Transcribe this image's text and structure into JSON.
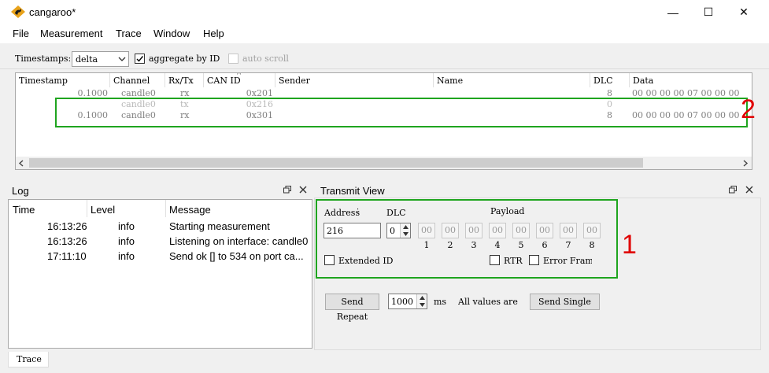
{
  "window": {
    "title": "cangaroo*",
    "minimize": "—",
    "maximize": "☐",
    "close": "✕"
  },
  "menu": [
    "File",
    "Measurement",
    "Trace",
    "Window",
    "Help"
  ],
  "toolbar": {
    "timestamps_label": "Timestamps:",
    "timestamps_value": "delta",
    "aggregate_label": "aggregate by ID",
    "aggregate_checked": true,
    "autoscroll_label": "auto scroll",
    "autoscroll_checked": false
  },
  "trace": {
    "columns": [
      "Timestamp",
      "Channel",
      "Rx/Tx",
      "CAN ID",
      "Sender",
      "Name",
      "DLC",
      "Data"
    ],
    "sort_indicator": "^",
    "rows": [
      {
        "timestamp": "0.1000",
        "channel": "candle0",
        "rxtx": "rx",
        "can_id": "0x201",
        "sender": "",
        "name": "",
        "dlc": "8",
        "data": "00 00 00 00 07 00 00 00",
        "dim": false
      },
      {
        "timestamp": "",
        "channel": "candle0",
        "rxtx": "tx",
        "can_id": "0x216",
        "sender": "",
        "name": "",
        "dlc": "0",
        "data": "",
        "dim": true
      },
      {
        "timestamp": "0.1000",
        "channel": "candle0",
        "rxtx": "rx",
        "can_id": "0x301",
        "sender": "",
        "name": "",
        "dlc": "8",
        "data": "00 00 00 00 07 00 00 00",
        "dim": false
      }
    ],
    "annotation": "2"
  },
  "log": {
    "title": "Log",
    "columns": [
      "Time",
      "Level",
      "Message"
    ],
    "rows": [
      {
        "time": "16:13:26",
        "level": "info",
        "message": "Starting measurement"
      },
      {
        "time": "16:13:26",
        "level": "info",
        "message": "Listening on interface: candle0"
      },
      {
        "time": "17:11:10",
        "level": "info",
        "message": "Send ok [] to 534 on port ca..."
      }
    ]
  },
  "transmit": {
    "title": "Transmit View",
    "address_label": "Address",
    "address_value": "216",
    "dlc_label": "DLC",
    "dlc_value": "0",
    "payload_label": "Payload",
    "bytes": [
      "00",
      "00",
      "00",
      "00",
      "00",
      "00",
      "00",
      "00"
    ],
    "byte_indices": [
      "1",
      "2",
      "3",
      "4",
      "5",
      "6",
      "7",
      "8"
    ],
    "extended_id_label": "Extended ID",
    "rtr_label": "RTR",
    "error_frame_label": "Error Fram",
    "annotation": "1",
    "send_repeat_label": "Send Repeat",
    "interval_value": "1000",
    "interval_unit": "ms",
    "all_values_label": "All values are",
    "send_single_label": "Send Single"
  },
  "status": {
    "tab_label": "Trace"
  },
  "colors": {
    "annotation_box": "#1fa51f",
    "annotation_number": "#e00000"
  }
}
